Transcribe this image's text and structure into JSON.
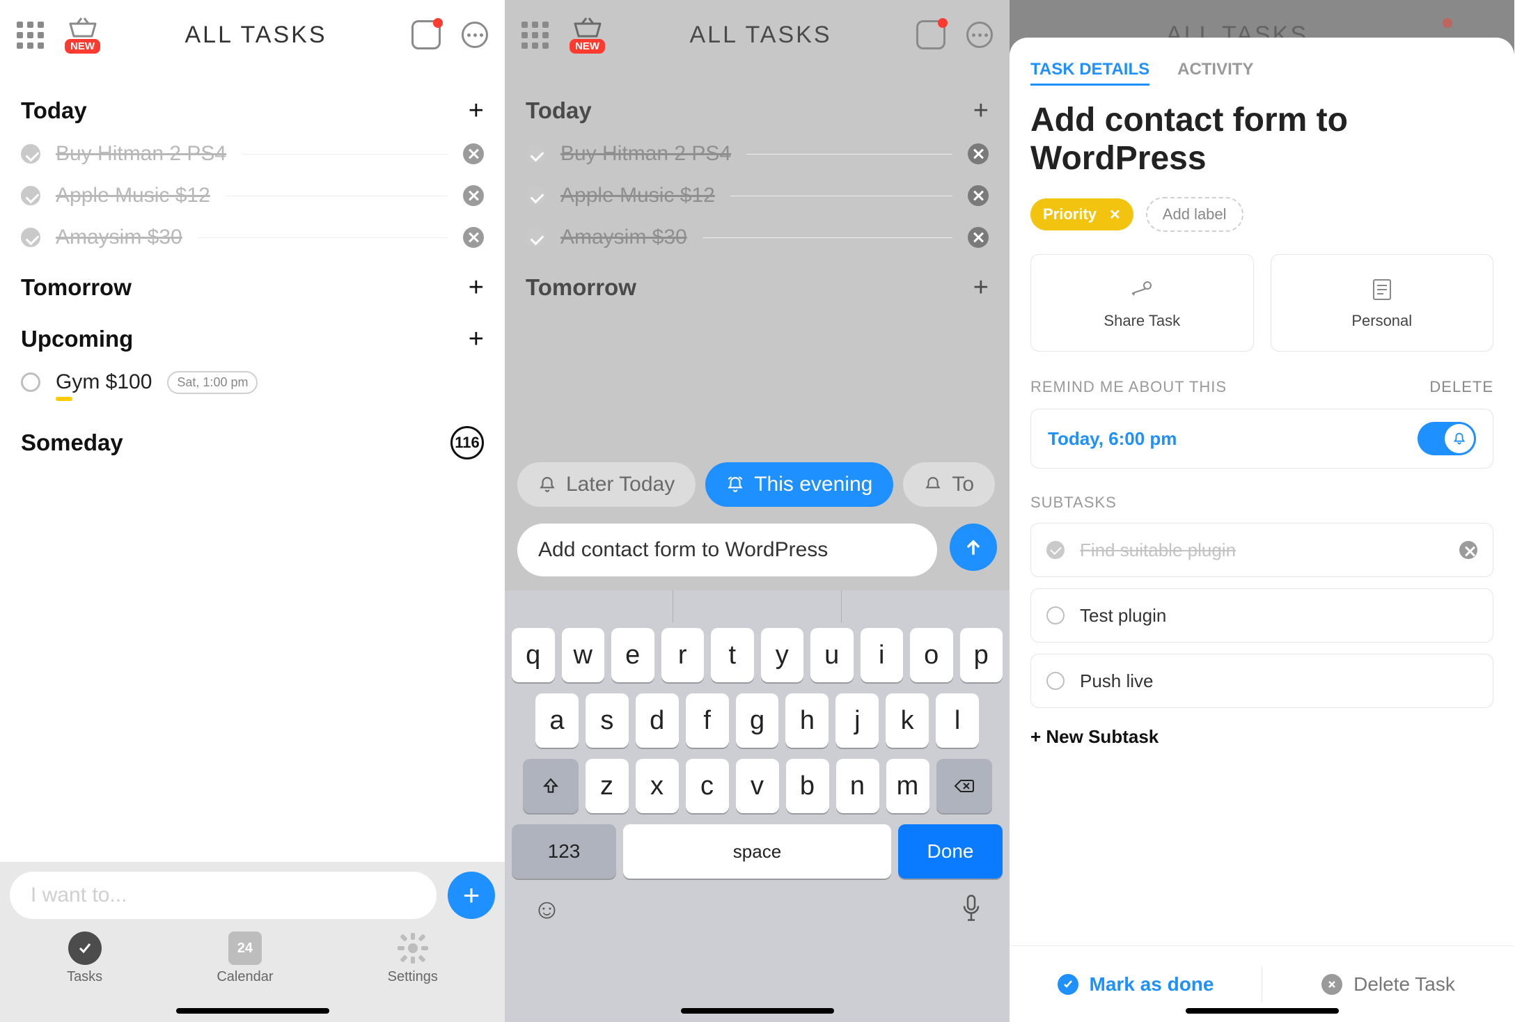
{
  "header": {
    "title": "ALL TASKS",
    "new_badge": "NEW"
  },
  "screen1": {
    "sections": {
      "today": {
        "label": "Today",
        "tasks": [
          {
            "text": "Buy Hitman 2 PS4",
            "done": true
          },
          {
            "text": "Apple Music $12",
            "done": true
          },
          {
            "text": "Amaysim $30",
            "done": true
          }
        ]
      },
      "tomorrow": {
        "label": "Tomorrow"
      },
      "upcoming": {
        "label": "Upcoming",
        "tasks": [
          {
            "text": "Gym $100",
            "pill": "Sat, 1:00 pm"
          }
        ]
      },
      "someday": {
        "label": "Someday",
        "count": "116"
      }
    },
    "input_placeholder": "I want to...",
    "nav": {
      "tasks": "Tasks",
      "calendar": "Calendar",
      "calendar_day": "24",
      "settings": "Settings"
    }
  },
  "screen2": {
    "chips": {
      "later": "Later Today",
      "evening": "This evening",
      "tomorrow": "To"
    },
    "input_value": "Add contact form to WordPress",
    "keyboard": {
      "row1": [
        "q",
        "w",
        "e",
        "r",
        "t",
        "y",
        "u",
        "i",
        "o",
        "p"
      ],
      "row2": [
        "a",
        "s",
        "d",
        "f",
        "g",
        "h",
        "j",
        "k",
        "l"
      ],
      "row3": [
        "z",
        "x",
        "c",
        "v",
        "b",
        "n",
        "m"
      ],
      "num": "123",
      "space": "space",
      "done": "Done"
    }
  },
  "screen3": {
    "tabs": {
      "details": "TASK DETAILS",
      "activity": "ACTIVITY"
    },
    "title": "Add contact form to WordPress",
    "priority": "Priority",
    "add_label": "Add label",
    "cards": {
      "share": "Share Task",
      "personal": "Personal"
    },
    "remind": {
      "label": "REMIND ME ABOUT THIS",
      "delete": "DELETE",
      "when": "Today, 6:00 pm"
    },
    "subtasks": {
      "label": "SUBTASKS",
      "items": [
        {
          "text": "Find suitable plugin",
          "done": true
        },
        {
          "text": "Test plugin",
          "done": false
        },
        {
          "text": "Push live",
          "done": false
        }
      ],
      "new": "+ New Subtask"
    },
    "footer": {
      "mark": "Mark as done",
      "delete": "Delete Task"
    }
  }
}
